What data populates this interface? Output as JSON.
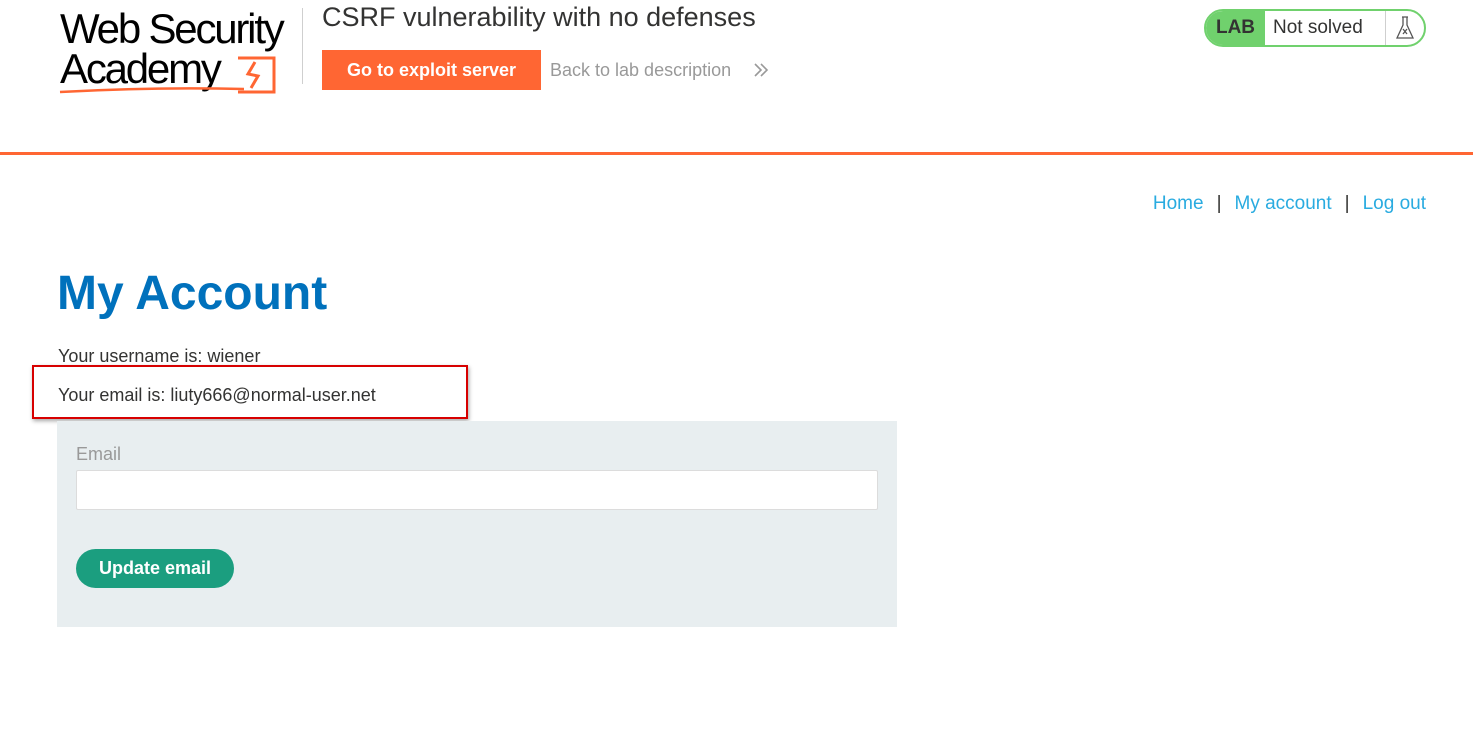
{
  "header": {
    "logo": {
      "line1": "Web Security",
      "line2": "Academy"
    },
    "lab_title": "CSRF vulnerability with no defenses",
    "exploit_button_label": "Go to exploit server",
    "back_link_label": "Back to lab description",
    "lab_status": {
      "badge": "LAB",
      "state": "Not solved"
    }
  },
  "nav": {
    "items": [
      {
        "label": "Home"
      },
      {
        "label": "My account"
      },
      {
        "label": "Log out"
      }
    ],
    "separator": "|"
  },
  "main": {
    "heading": "My Account",
    "username_text": "Your username is: wiener",
    "email_text": "Your email is: liuty666@normal-user.net",
    "form": {
      "email_label": "Email",
      "email_value": "",
      "submit_label": "Update email"
    }
  },
  "colors": {
    "brand_orange": "#ff6633",
    "lab_green": "#70d16d",
    "heading_blue": "#0071bc",
    "link_blue": "#29abe0",
    "button_teal": "#1b9e7f",
    "form_background": "#e8eef0",
    "annotation_red": "#d70000"
  },
  "icons": {
    "logo_mark": "lightning-bracket-icon",
    "back_chevron": "double-chevron-right-icon",
    "lab_flask": "flask-icon"
  }
}
